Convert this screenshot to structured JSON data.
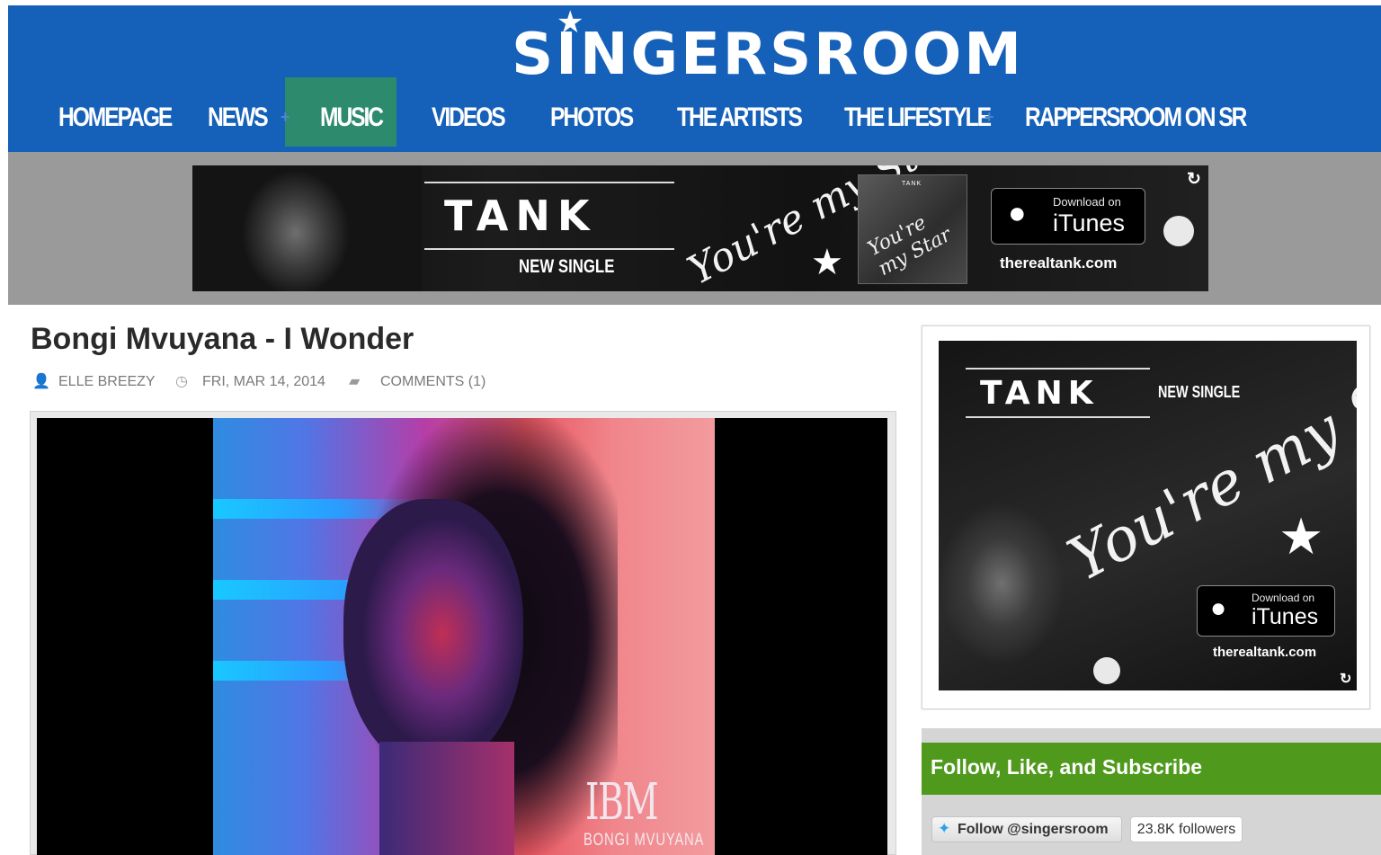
{
  "site": {
    "logo_text": "SINGERSROOM"
  },
  "nav": {
    "items": [
      {
        "label": "HOMEPAGE"
      },
      {
        "label": "NEWS"
      },
      {
        "label": "MUSIC"
      },
      {
        "label": "VIDEOS"
      },
      {
        "label": "PHOTOS"
      },
      {
        "label": "THE ARTISTS"
      },
      {
        "label": "THE LIFESTYLE"
      },
      {
        "label": "RAPPERSROOM ON SR"
      }
    ],
    "active": "MUSIC",
    "plus": "+"
  },
  "banner_ad": {
    "artist": "TANK",
    "subtitle": "NEW SINGLE",
    "song_script": "You're my Star",
    "store_small": "Download on",
    "store_big": "iTunes",
    "url": "therealtank.com",
    "cover_artist": "TANK"
  },
  "article": {
    "title": "Bongi Mvuyana - I Wonder",
    "author": "ELLE BREEZY",
    "date": "FRI, MAR 14, 2014",
    "comments": "COMMENTS (1)",
    "cover_logo": "IBM",
    "cover_name": "BONGI MVUYANA"
  },
  "sidebar_ad": {
    "artist": "TANK",
    "subtitle": "NEW SINGLE",
    "song_script": "You're my Star",
    "store_small": "Download on",
    "store_big": "iTunes",
    "url": "therealtank.com"
  },
  "follow_widget": {
    "title": "Follow, Like, and Subscribe",
    "twitter_button": "Follow @singersroom",
    "followers": "23.8K followers"
  },
  "colors": {
    "header_blue": "#1560b8",
    "nav_active": "#2e8a6d",
    "follow_green": "#4f9a1c",
    "twitter_blue": "#2aa3ef"
  }
}
